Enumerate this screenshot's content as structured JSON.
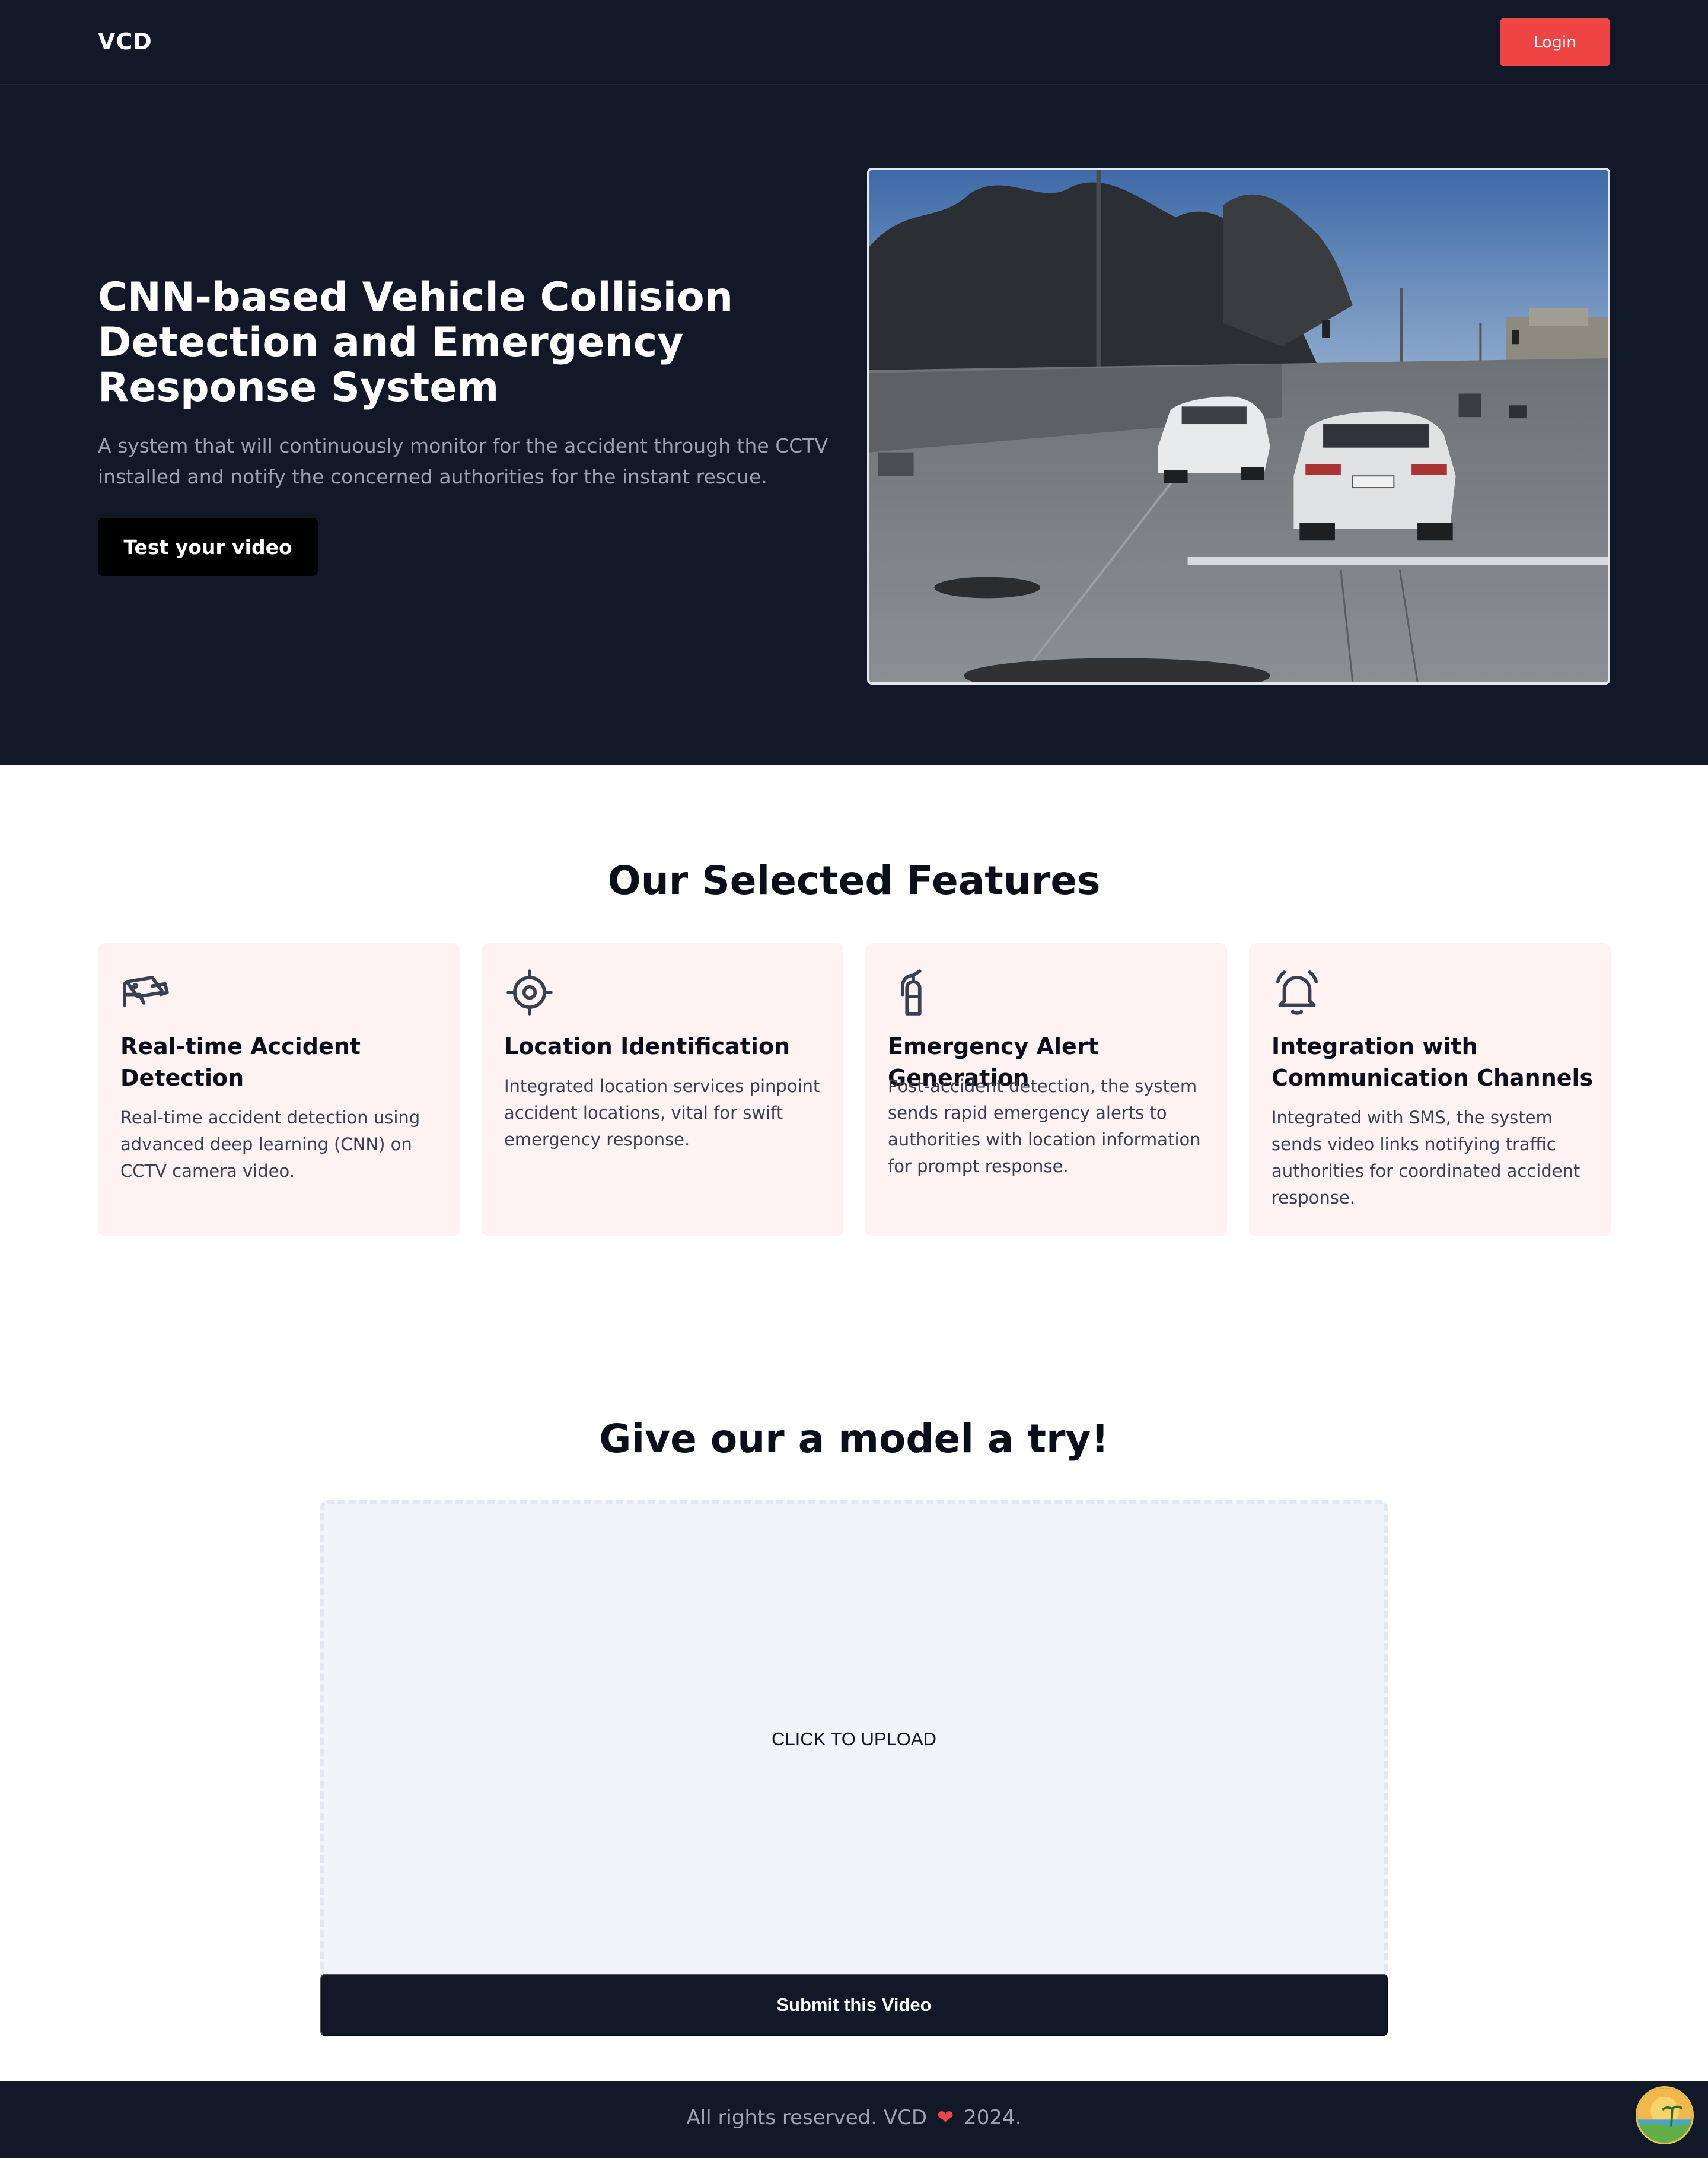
{
  "nav": {
    "brand": "VCD",
    "login_label": "Login"
  },
  "hero": {
    "title": "CNN-based Vehicle Collision Detection and Emergency Response System",
    "description": "A system that will continuously monitor for the accident through the CCTV installed and notify the concerned authorities for the instant rescue.",
    "cta_label": "Test your video"
  },
  "features": {
    "title": "Our Selected Features",
    "items": [
      {
        "icon": "cctv-camera-icon",
        "heading": "Real-time Accident Detection",
        "text": "Real-time accident detection using advanced deep learning (CNN) on CCTV camera video."
      },
      {
        "icon": "location-target-icon",
        "heading": "Location Identification",
        "text": "Integrated location services pinpoint accident locations, vital for swift emergency response."
      },
      {
        "icon": "fire-extinguisher-icon",
        "heading": "Emergency Alert Generation",
        "text": "Post-accident detection, the system sends rapid emergency alerts to authorities with location information for prompt response."
      },
      {
        "icon": "bell-icon",
        "heading": "Integration with Communication Channels",
        "text": "Integrated with SMS, the system sends video links notifying traffic authorities for coordinated accident response."
      }
    ]
  },
  "try_model": {
    "title": "Give our a model a try!",
    "upload_label": "CLICK TO UPLOAD",
    "submit_label": "Submit this Video"
  },
  "footer": {
    "text_before": "All rights reserved. VCD",
    "heart": "❤",
    "text_after": "2024."
  },
  "colors": {
    "dark": "#111827",
    "accent_red": "#ef4444",
    "card_bg": "#fef2f2",
    "upload_bg": "#f1f5f9"
  }
}
